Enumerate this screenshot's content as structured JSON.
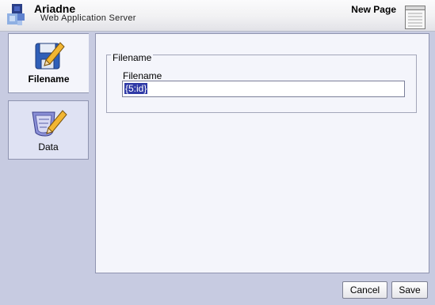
{
  "header": {
    "app_title": "Ariadne",
    "app_subtitle": "Web Application Server",
    "page_title": "New Page",
    "logo_icon": "ariadne-logo-icon",
    "page_icon": "notepad-icon"
  },
  "tabs": [
    {
      "label": "Filename",
      "icon": "filename-edit-icon",
      "active": true
    },
    {
      "label": "Data",
      "icon": "data-edit-icon",
      "active": false
    }
  ],
  "form": {
    "legend": "Filename",
    "field_label": "Filename",
    "field_value": "{5:id}"
  },
  "buttons": {
    "cancel_label": "Cancel",
    "save_label": "Save"
  },
  "colors": {
    "background": "#c7cbe1",
    "panel": "#f4f5fb",
    "selection": "#2f3aa6"
  }
}
